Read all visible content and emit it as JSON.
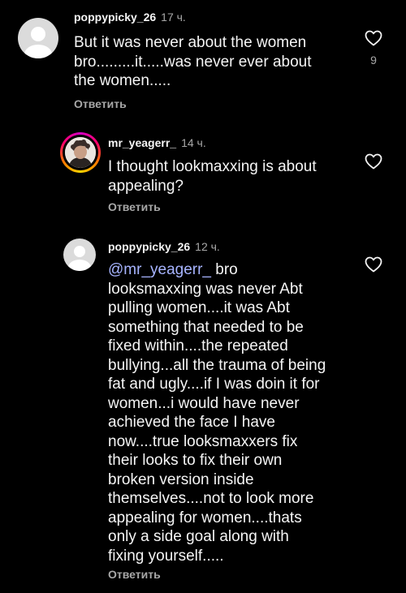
{
  "comments": [
    {
      "username": "poppypicky_26",
      "time": "17 ч.",
      "lines": [
        "But it was never about the women",
        "bro.........it.....was never ever about",
        "the women....."
      ],
      "reply_label": "Ответить",
      "like_count": "9"
    },
    {
      "username": "mr_yeagerr_",
      "time": "14 ч.",
      "lines": [
        "I thought lookmaxxing is about",
        "appealing?"
      ],
      "reply_label": "Ответить"
    },
    {
      "username": "poppypicky_26",
      "time": "12 ч.",
      "mention": "@mr_yeagerr_",
      "first_line_rest": " bro",
      "lines": [
        "looksmaxxing was never Abt",
        "pulling women....it was Abt",
        "something that needed to be",
        "fixed within....the repeated",
        "bullying...all the trauma of being",
        "fat and ugly....if I was doin it for",
        "women...i would have never",
        "achieved the face I have",
        "now....true looksmaxxers fix",
        "their looks to fix their own",
        "broken version inside",
        "themselves....not to look more",
        "appealing for women....thats",
        "only a side goal along with",
        "fixing yourself....."
      ],
      "reply_label": "Ответить"
    }
  ],
  "icons": {
    "like": "heart-outline-icon",
    "avatar_default": "default-avatar-icon"
  },
  "colors": {
    "background": "#000000",
    "text": "#f5f5f5",
    "secondary": "#a8a8a8",
    "mention": "#a7b4ff",
    "default_avatar": "#dbdbdb"
  }
}
